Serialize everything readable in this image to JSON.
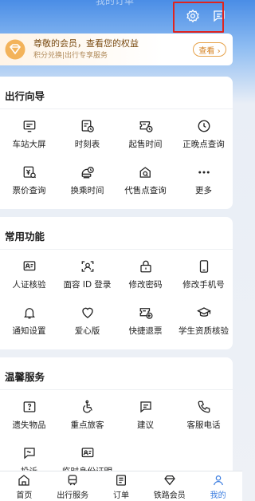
{
  "header": {
    "faded_title": "我的订单"
  },
  "member": {
    "title": "尊敬的会员，查看您的权益",
    "subtitle": "积分兑换|出行专享服务",
    "button_label": "查看 ›"
  },
  "travel_guide": {
    "title": "出行向导",
    "items": [
      {
        "label": "车站大屏",
        "icon": "station-screen-icon"
      },
      {
        "label": "时刻表",
        "icon": "timetable-icon"
      },
      {
        "label": "起售时间",
        "icon": "sale-time-icon"
      },
      {
        "label": "正晚点查询",
        "icon": "clock-icon"
      },
      {
        "label": "票价查询",
        "icon": "fare-query-icon"
      },
      {
        "label": "换乘时间",
        "icon": "transfer-time-icon"
      },
      {
        "label": "代售点查询",
        "icon": "agency-query-icon"
      },
      {
        "label": "更多",
        "icon": "more-icon"
      }
    ]
  },
  "common": {
    "title": "常用功能",
    "items": [
      {
        "label": "人证核验",
        "icon": "id-verify-icon"
      },
      {
        "label": "面容 ID 登录",
        "icon": "face-id-icon"
      },
      {
        "label": "修改密码",
        "icon": "lock-icon"
      },
      {
        "label": "修改手机号",
        "icon": "phone-icon"
      },
      {
        "label": "通知设置",
        "icon": "bell-icon"
      },
      {
        "label": "爱心版",
        "icon": "heart-icon"
      },
      {
        "label": "快捷退票",
        "icon": "refund-ticket-icon"
      },
      {
        "label": "学生资质核验",
        "icon": "graduation-cap-icon"
      }
    ]
  },
  "warm": {
    "title": "温馨服务",
    "items": [
      {
        "label": "遗失物品",
        "icon": "lost-item-icon"
      },
      {
        "label": "重点旅客",
        "icon": "wheelchair-icon"
      },
      {
        "label": "建议",
        "icon": "suggestion-icon"
      },
      {
        "label": "客服电话",
        "icon": "phone-call-icon"
      },
      {
        "label": "投诉",
        "icon": "complaint-icon"
      },
      {
        "label": "临时身份证明",
        "icon": "temp-id-icon"
      }
    ]
  },
  "tabbar": {
    "items": [
      {
        "label": "首页",
        "icon": "home-icon"
      },
      {
        "label": "出行服务",
        "icon": "train-icon"
      },
      {
        "label": "订单",
        "icon": "order-icon"
      },
      {
        "label": "铁路会员",
        "icon": "diamond-icon"
      },
      {
        "label": "我的",
        "icon": "user-icon"
      }
    ]
  },
  "colors": {
    "accent": "#3b7de0",
    "highlight": "#e0241f",
    "member_gold": "#d4801f"
  }
}
